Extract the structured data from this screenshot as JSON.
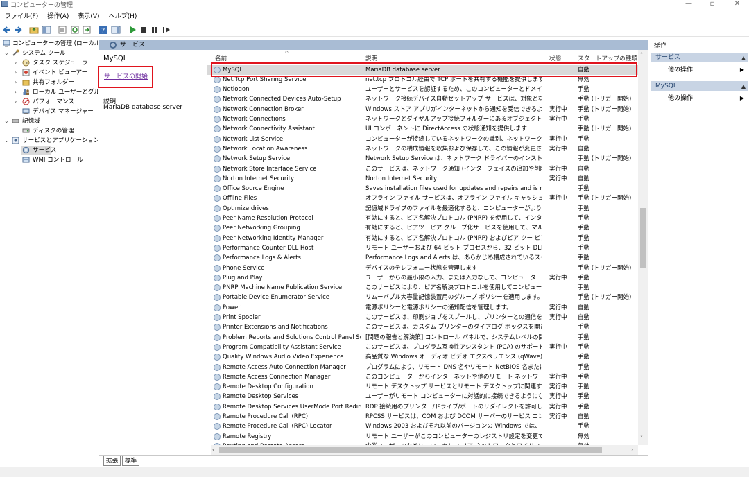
{
  "window": {
    "title": "コンピューターの管理"
  },
  "menu": [
    "ファイル(F)",
    "操作(A)",
    "表示(V)",
    "ヘルプ(H)"
  ],
  "tree": {
    "root": "コンピューターの管理 (ローカル)",
    "system_tools": "システム ツール",
    "task_scheduler": "タスク スケジューラ",
    "event_viewer": "イベント ビューアー",
    "shared_folders": "共有フォルダー",
    "local_users": "ローカル ユーザーとグループ",
    "performance": "パフォーマンス",
    "device_manager": "デバイス マネージャー",
    "storage": "記憶域",
    "disk_management": "ディスクの管理",
    "services_apps": "サービスとアプリケーション",
    "services": "サービス",
    "wmi": "WMI コントロール"
  },
  "services_header": "サービス",
  "description_pane": {
    "name": "MySQL",
    "start_link": "サービスの開始",
    "desc_label": "説明:",
    "desc_text": "MariaDB database server"
  },
  "columns": {
    "name": "名前",
    "description": "説明",
    "status": "状態",
    "startup": "スタートアップの種類"
  },
  "services": [
    {
      "name": "MySQL",
      "desc": "MariaDB database server",
      "status": "",
      "startup": "自動"
    },
    {
      "name": "Net.Tcp Port Sharing Service",
      "desc": "net.tcp プロトコル経由で TCP ポートを共有する機能を提供します。",
      "status": "",
      "startup": "無効"
    },
    {
      "name": "Netlogon",
      "desc": "ユーザーとサービスを認証するため、このコンピューターとドメイン コントローラー...",
      "status": "",
      "startup": "手動"
    },
    {
      "name": "Network Connected Devices Auto-Setup",
      "desc": "ネットワーク接続デバイス自動セットアップ サービスは、対象となるネットワ...",
      "status": "",
      "startup": "手動 (トリガー開始)"
    },
    {
      "name": "Network Connection Broker",
      "desc": "Windows ストア アプリがインターネットから通知を受信できるようにす...",
      "status": "実行中",
      "startup": "手動 (トリガー開始)"
    },
    {
      "name": "Network Connections",
      "desc": "ネットワークとダイヤルアップ接続フォルダーにあるオブジェクトを管理します...",
      "status": "実行中",
      "startup": "手動"
    },
    {
      "name": "Network Connectivity Assistant",
      "desc": "UI コンポーネントに DirectAccess の状態通知を提供します",
      "status": "",
      "startup": "手動 (トリガー開始)"
    },
    {
      "name": "Network List Service",
      "desc": "コンピューターが接続しているネットワークの識別、ネットワークのプロパティの...",
      "status": "実行中",
      "startup": "手動"
    },
    {
      "name": "Network Location Awareness",
      "desc": "ネットワークの構成情報を収集および保存して、この情報が変更されたと...",
      "status": "実行中",
      "startup": "自動"
    },
    {
      "name": "Network Setup Service",
      "desc": "Network Setup Service は、ネットワーク ドライバーのインストールを管理...",
      "status": "",
      "startup": "手動 (トリガー開始)"
    },
    {
      "name": "Network Store Interface Service",
      "desc": "このサービスは、ネットワーク通知 (インターフェイスの追加や削除など) をユ...",
      "status": "実行中",
      "startup": "自動"
    },
    {
      "name": "Norton Internet Security",
      "desc": "Norton Internet Security",
      "status": "実行中",
      "startup": "自動"
    },
    {
      "name": "Office  Source Engine",
      "desc": "Saves installation files used for updates and repairs and is requi...",
      "status": "",
      "startup": "手動"
    },
    {
      "name": "Offline Files",
      "desc": "オフライン ファイル サービスは、オフライン ファイル キャッシュのメンテナンス活...",
      "status": "実行中",
      "startup": "手動 (トリガー開始)"
    },
    {
      "name": "Optimize drives",
      "desc": "記憶域ドライブのファイルを最適化すると、コンピューターがより効率的に動...",
      "status": "",
      "startup": "手動"
    },
    {
      "name": "Peer Name Resolution Protocol",
      "desc": "有効にすると、ピア名解決プロトコル (PNRP) を使用して、インターネット...",
      "status": "",
      "startup": "手動"
    },
    {
      "name": "Peer Networking Grouping",
      "desc": "有効にすると、ピアツーピア グループ化サービスを使用して、マルチパーティ通...",
      "status": "",
      "startup": "手動"
    },
    {
      "name": "Peer Networking Identity Manager",
      "desc": "有効にすると、ピア名解決プロトコル (PNRP) およびピア ツー ピア グループ...",
      "status": "",
      "startup": "手動"
    },
    {
      "name": "Performance Counter DLL Host",
      "desc": "リモート ユーザーおよび 64 ビット プロセスから、32 ビット DLL が提供するパ...",
      "status": "",
      "startup": "手動"
    },
    {
      "name": "Performance Logs & Alerts",
      "desc": "Performance Logs and Alerts は、あらかじめ構成されているスケジュー...",
      "status": "",
      "startup": "手動"
    },
    {
      "name": "Phone Service",
      "desc": "デバイスのテレフォニー状態を管理します",
      "status": "",
      "startup": "手動 (トリガー開始)"
    },
    {
      "name": "Plug and Play",
      "desc": "ユーザーからの最小限の入力、または入力なしで、コンピューターがハードウ...",
      "status": "実行中",
      "startup": "手動"
    },
    {
      "name": "PNRP Machine Name Publication Service",
      "desc": "このサービスにより、ピア名解決プロトコルを使用してコンピューター名が公...",
      "status": "",
      "startup": "手動"
    },
    {
      "name": "Portable Device Enumerator Service",
      "desc": "リムーバブル大容量記憶装置用のグループ ポリシーを適用します。Wind...",
      "status": "",
      "startup": "手動 (トリガー開始)"
    },
    {
      "name": "Power",
      "desc": "電源ポリシーと電源ポリシーの通知配信を管理します。",
      "status": "実行中",
      "startup": "自動"
    },
    {
      "name": "Print Spooler",
      "desc": "このサービスは、印刷ジョブをスプールし、プリンターとの通信を処理します。...",
      "status": "実行中",
      "startup": "自動"
    },
    {
      "name": "Printer Extensions and Notifications",
      "desc": "このサービスは、カスタム プリンターのダイアログ ボックスを開き、リモートのプ...",
      "status": "",
      "startup": "手動"
    },
    {
      "name": "Problem Reports and Solutions Control Panel Sup...",
      "desc": "[問題の報告と解決策] コントロール パネルで、システムレベルの問題レポ...",
      "status": "",
      "startup": "手動"
    },
    {
      "name": "Program Compatibility Assistant Service",
      "desc": "このサービスは、プログラム互換性アシスタント (PCA) のサポートを提供しま...",
      "status": "実行中",
      "startup": "手動"
    },
    {
      "name": "Quality Windows Audio Video Experience",
      "desc": "高品質な Windows オーディオ ビデオ エクスペリエンス (qWave) は、IP ...",
      "status": "",
      "startup": "手動"
    },
    {
      "name": "Remote Access Auto Connection Manager",
      "desc": "プログラムにより、リモート DNS 名やリモート NetBIOS 名またはアドレスが...",
      "status": "",
      "startup": "手動"
    },
    {
      "name": "Remote Access Connection Manager",
      "desc": "このコンピューターからインターネットや他のリモート ネットワークへのダイヤル...",
      "status": "実行中",
      "startup": "手動"
    },
    {
      "name": "Remote Desktop Configuration",
      "desc": "リモート デスクトップ サービスとリモート デスクトップに関連する、SYSTEM コ...",
      "status": "実行中",
      "startup": "手動"
    },
    {
      "name": "Remote Desktop Services",
      "desc": "ユーザーがリモート コンピューターに対話的に接続できるようになります。リモ...",
      "status": "実行中",
      "startup": "手動"
    },
    {
      "name": "Remote Desktop Services UserMode Port Redirect...",
      "desc": "RDP 接続用のプリンター/ドライブ/ポートのリダイレクトを許可します",
      "status": "実行中",
      "startup": "手動"
    },
    {
      "name": "Remote Procedure Call (RPC)",
      "desc": "RPCSS サービスは、COM および DCOM サーバーのサービス コントロール マ...",
      "status": "実行中",
      "startup": "自動"
    },
    {
      "name": "Remote Procedure Call (RPC) Locator",
      "desc": "Windows 2003 およびそれ以前のバージョンの Windows では、リモート ...",
      "status": "",
      "startup": "手動"
    },
    {
      "name": "Remote Registry",
      "desc": "リモート ユーザーがこのコンピューターのレジストリ設定を変更できるようにしま...",
      "status": "",
      "startup": "無効"
    },
    {
      "name": "Routing and Remote Access",
      "desc": "企業ユーザーのために、ローカル エリア ネットワークとワイド エリア ネットワー...",
      "status": "",
      "startup": "無効"
    }
  ],
  "tabs": [
    "拡張",
    "標準"
  ],
  "actions": {
    "title": "操作",
    "section1": "サービス",
    "section1_item": "他の操作",
    "section2": "MySQL",
    "section2_item": "他の操作"
  }
}
